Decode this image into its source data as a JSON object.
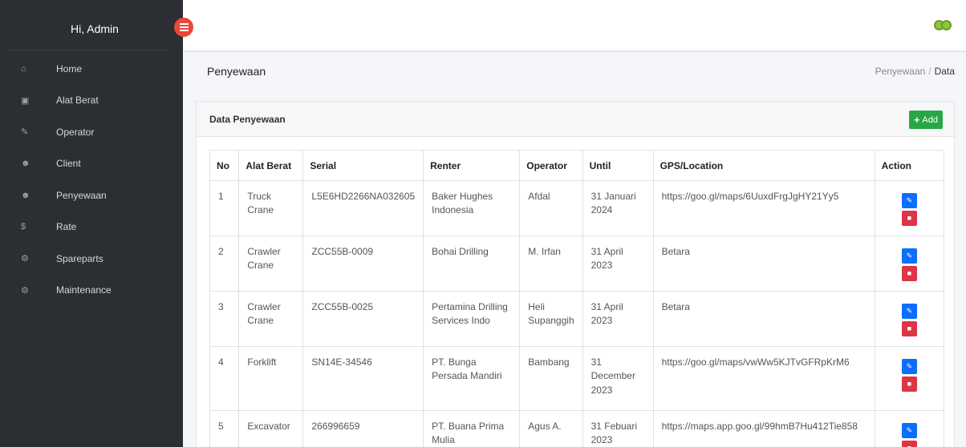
{
  "sidebar": {
    "greeting": "Hi, Admin",
    "items": [
      {
        "icon": "home-icon",
        "label": "Home",
        "glyph": "⌂"
      },
      {
        "icon": "plus-square-icon",
        "label": "Alat Berat",
        "glyph": "▣"
      },
      {
        "icon": "wrench-icon",
        "label": "Operator",
        "glyph": "✎"
      },
      {
        "icon": "users-icon",
        "label": "Client",
        "glyph": "☻"
      },
      {
        "icon": "users-icon",
        "label": "Penyewaan",
        "glyph": "☻"
      },
      {
        "icon": "dollar-icon",
        "label": "Rate",
        "glyph": "$"
      },
      {
        "icon": "cogs-icon",
        "label": "Spareparts",
        "glyph": "⚙"
      },
      {
        "icon": "cogs-icon",
        "label": "Maintenance",
        "glyph": "⚙"
      }
    ]
  },
  "header": {
    "title": "Penyewaan",
    "breadcrumb": {
      "parent": "Penyewaan",
      "separator": "/",
      "current": "Data"
    }
  },
  "card": {
    "title": "Data Penyewaan",
    "add_label": "Add"
  },
  "table": {
    "columns": [
      "No",
      "Alat Berat",
      "Serial",
      "Renter",
      "Operator",
      "Until",
      "GPS/Location",
      "Action"
    ],
    "rows": [
      {
        "no": "1",
        "alat": "Truck Crane",
        "serial": "L5E6HD2266NA032605",
        "renter": "Baker Hughes Indonesia",
        "operator": "Afdal",
        "until": "31 Januari 2024",
        "gps": "https://goo.gl/maps/6UuxdFrgJgHY21Yy5"
      },
      {
        "no": "2",
        "alat": "Crawler Crane",
        "serial": "ZCC55B-0009",
        "renter": "Bohai Drilling",
        "operator": "M. Irfan",
        "until": "31 April 2023",
        "gps": "Betara"
      },
      {
        "no": "3",
        "alat": "Crawler Crane",
        "serial": "ZCC55B-0025",
        "renter": "Pertamina Drilling Services Indo",
        "operator": "Heli Supanggih",
        "until": "31 April 2023",
        "gps": "Betara"
      },
      {
        "no": "4",
        "alat": "Forklift",
        "serial": "SN14E-34546",
        "renter": "PT. Bunga Persada Mandiri",
        "operator": "Bambang",
        "until": "31 December 2023",
        "gps": "https://goo.gl/maps/vwWw5KJTvGFRpKrM6"
      },
      {
        "no": "5",
        "alat": "Excavator",
        "serial": "266996659",
        "renter": "PT. Buana Prima Mulia",
        "operator": "Agus A.",
        "until": "31 Febuari 2023",
        "gps": "https://maps.app.goo.gl/99hmB7Hu412Tie858"
      }
    ]
  },
  "colors": {
    "sidebar": "#2b2f33",
    "add": "#28a745",
    "edit": "#0d6efd",
    "delete": "#dc3545",
    "toggle": "#e9473b"
  }
}
